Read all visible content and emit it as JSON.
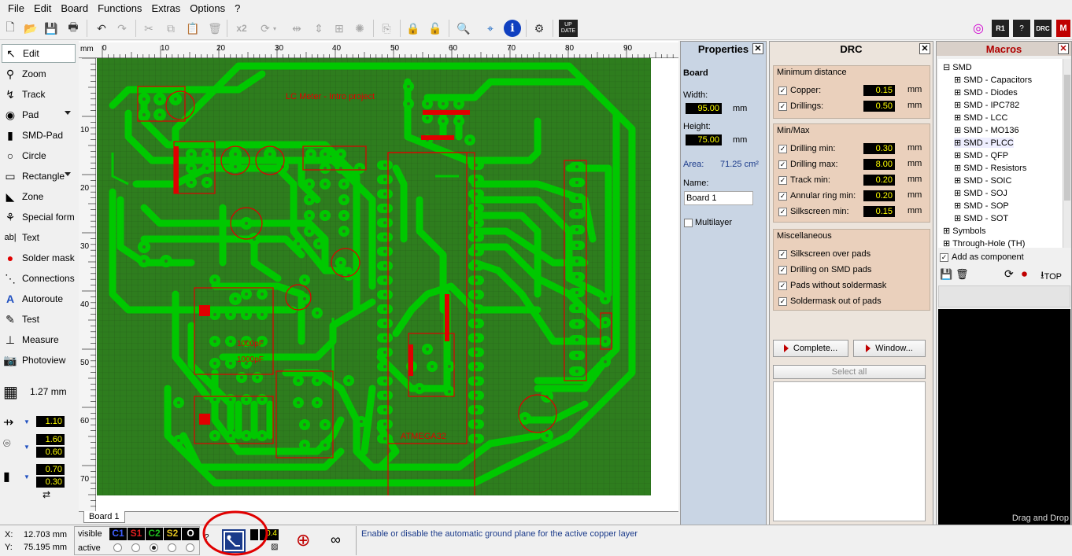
{
  "menu": [
    "File",
    "Edit",
    "Board",
    "Functions",
    "Extras",
    "Options",
    "?"
  ],
  "toolbar": {
    "x2_label": "x2",
    "update_label_top": "UP",
    "update_label_bottom": "DATE",
    "r1_label": "R1",
    "drc_label": "DRC"
  },
  "tools": [
    {
      "label": "Edit",
      "icon": "cursor-icon"
    },
    {
      "label": "Zoom",
      "icon": "magnifier-icon"
    },
    {
      "label": "Track",
      "icon": "track-icon"
    },
    {
      "label": "Pad",
      "icon": "pad-icon"
    },
    {
      "label": "SMD-Pad",
      "icon": "smd-pad-icon"
    },
    {
      "label": "Circle",
      "icon": "circle-icon"
    },
    {
      "label": "Rectangle",
      "icon": "rectangle-icon"
    },
    {
      "label": "Zone",
      "icon": "zone-icon"
    },
    {
      "label": "Special form",
      "icon": "special-form-icon"
    },
    {
      "label": "Text",
      "icon": "text-icon"
    },
    {
      "label": "Solder mask",
      "icon": "solder-mask-icon"
    },
    {
      "label": "Connections",
      "icon": "connections-icon"
    },
    {
      "label": "Autoroute",
      "icon": "autoroute-icon"
    },
    {
      "label": "Test",
      "icon": "test-icon"
    },
    {
      "label": "Measure",
      "icon": "measure-icon"
    },
    {
      "label": "Photoview",
      "icon": "photoview-icon"
    }
  ],
  "grid": {
    "value": "1.27 mm"
  },
  "track_settings": {
    "width": "1.10",
    "pad_outer": "1.60",
    "pad_inner": "0.60",
    "smd_w": "0.70",
    "smd_h": "0.30"
  },
  "ruler": {
    "unit": "mm",
    "top": [
      "0",
      "10",
      "20",
      "30",
      "40",
      "50",
      "60",
      "70",
      "80",
      "90"
    ],
    "left": [
      "10",
      "20",
      "30",
      "40",
      "50",
      "60",
      "70"
    ]
  },
  "board_tab": "Board 1",
  "properties": {
    "title": "Properties",
    "section": "Board",
    "width_label": "Width:",
    "width": "95.00",
    "width_unit": "mm",
    "height_label": "Height:",
    "height": "75.00",
    "height_unit": "mm",
    "area_label": "Area:",
    "area": "71.25 cm²",
    "name_label": "Name:",
    "name": "Board 1",
    "multilayer": "Multilayer"
  },
  "drc": {
    "title": "DRC",
    "min_distance": {
      "title": "Minimum distance",
      "copper_label": "Copper:",
      "copper": "0.15",
      "drillings_label": "Drillings:",
      "drillings": "0.50"
    },
    "minmax": {
      "title": "Min/Max",
      "rows": [
        {
          "label": "Drilling min:",
          "value": "0.30"
        },
        {
          "label": "Drilling max:",
          "value": "8.00"
        },
        {
          "label": "Track min:",
          "value": "0.20"
        },
        {
          "label": "Annular ring min:",
          "value": "0.20"
        },
        {
          "label": "Silkscreen min:",
          "value": "0.15"
        }
      ]
    },
    "misc": {
      "title": "Miscellaneous",
      "rows": [
        "Silkscreen over pads",
        "Drilling on SMD pads",
        "Pads without soldermask",
        "Soldermask out of pads"
      ]
    },
    "unit": "mm",
    "complete_button": "Complete...",
    "window_button": "Window...",
    "select_all": "Select all"
  },
  "macros": {
    "title": "Macros",
    "root": "SMD",
    "items": [
      "SMD - Capacitors",
      "SMD - Diodes",
      "SMD - IPC782",
      "SMD - LCC",
      "SMD - MO136",
      "SMD - PLCC",
      "SMD - QFP",
      "SMD - Resistors",
      "SMD - SOIC",
      "SMD - SOJ",
      "SMD - SOP",
      "SMD - SOT"
    ],
    "other": [
      "Symbols",
      "Through-Hole (TH)"
    ],
    "add_as_component": "Add as component",
    "top_label": "TOP",
    "preview_hint": "Drag and Drop"
  },
  "pcb_labels": {
    "title": "LC Meter - Intro project",
    "mcu": "ATMEGA32",
    "cap1": "1000pF",
    "cap2": "1000pF"
  },
  "status": {
    "x_label": "X:",
    "x": "12.703 mm",
    "y_label": "Y:",
    "y": "75.195 mm",
    "visible_label": "visible",
    "active_label": "active",
    "layers": [
      "C1",
      "S1",
      "C2",
      "S2",
      "O"
    ],
    "layer_colors": [
      "#0000c0",
      "#c00000",
      "#007000",
      "#b08000",
      "#000000"
    ],
    "ground_value": "0.4",
    "hint": "Enable or disable the automatic ground plane for the active copper layer"
  },
  "colors": {
    "board_bg": "#2e7d1e",
    "copper": "#00c800",
    "silk": "#e00000",
    "highlight_circle": "#e00000"
  }
}
